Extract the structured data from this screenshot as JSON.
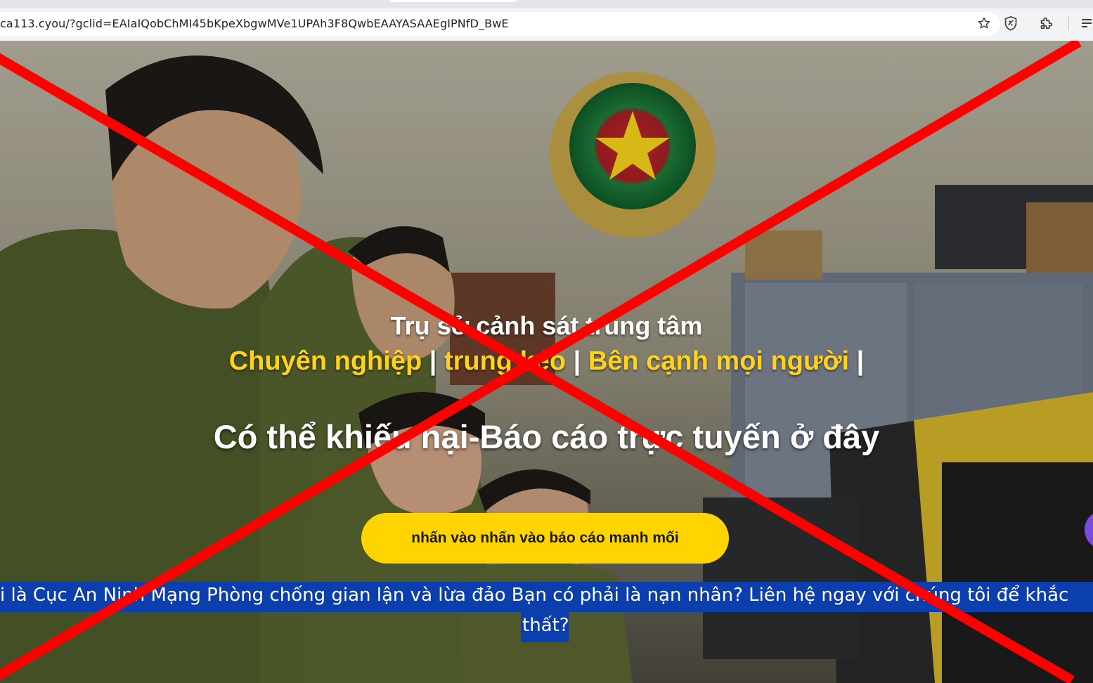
{
  "browser": {
    "url": "ca113.cyou/?gclid=EAIaIQobChMI45bKpeXbgwMVe1UPAh3F8QwbEAAYASAAEgIPNfD_BwE",
    "icons": [
      "star-icon",
      "shield-extension-icon",
      "puzzle-extensions-icon",
      "reading-list-icon"
    ]
  },
  "hero": {
    "heading": "Trụ sở cảnh sát trung tâm",
    "tagline": {
      "part1": "Chuyên nghiệp",
      "sep1": " | ",
      "part2": "trung kéo",
      "sep2": " | ",
      "part3": "Bên cạnh mọi người",
      "sep3": " |"
    },
    "subheading": "Có thể khiếu nại-Báo cáo trực tuyến ở đây",
    "cta_label": "nhấn vào nhấn vào báo cáo manh mối",
    "banner_line1": "i là Cục An Ninh Mạng Phòng chống gian lận và lừa đảo Bạn có phải là nạn nhân? Liên hệ ngay với chúng tôi để khắc",
    "banner_line2": "thất?"
  },
  "colors": {
    "accent_yellow": "#ffd400",
    "banner_blue": "#0b3fae",
    "cross_red": "#ff0000"
  }
}
